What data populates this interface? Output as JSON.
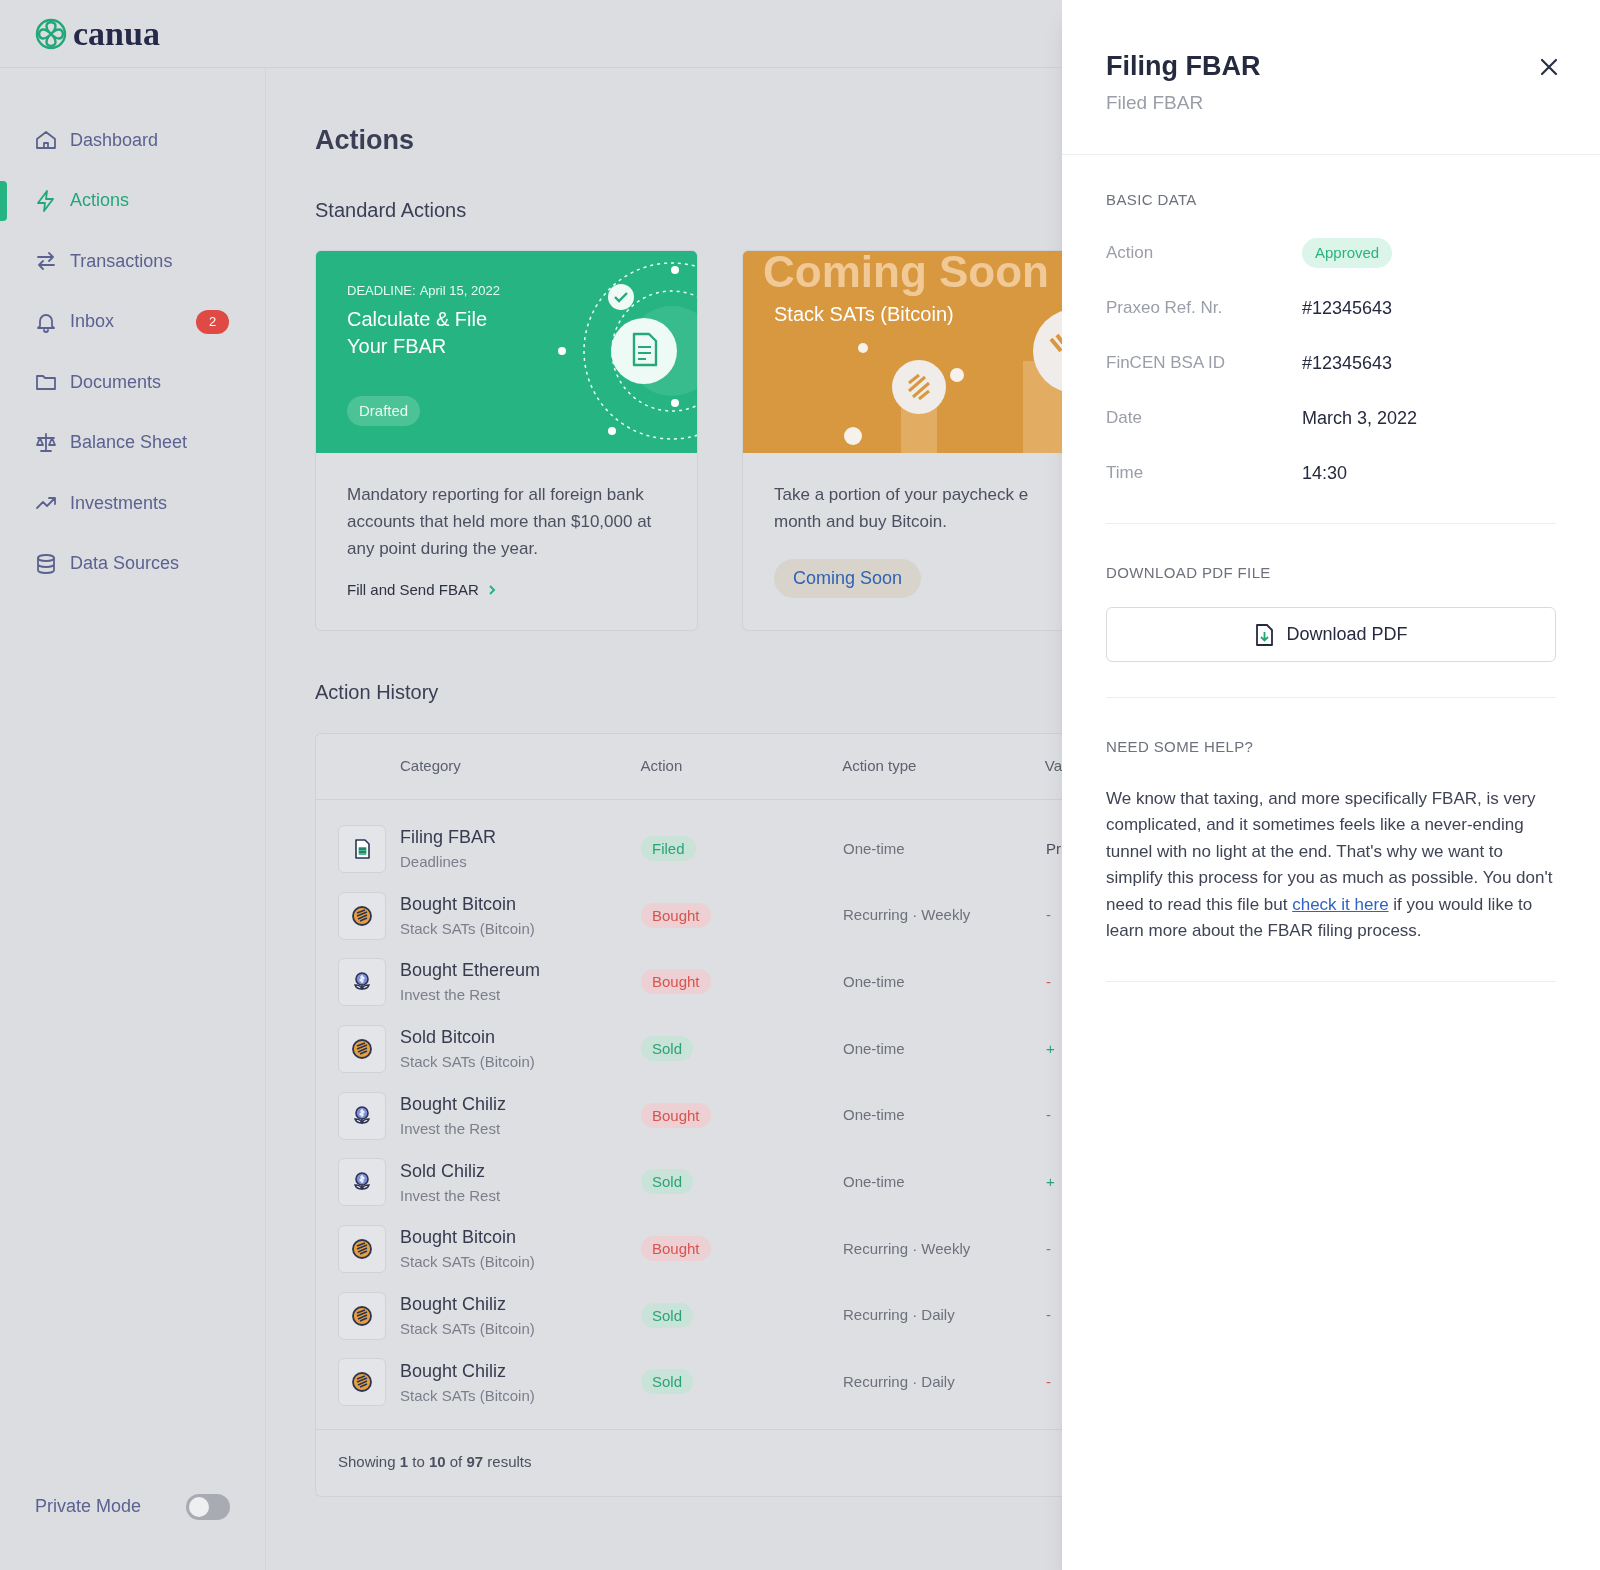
{
  "logo": {
    "text": "canua"
  },
  "sidebar": {
    "items": [
      {
        "label": "Dashboard",
        "selected": false
      },
      {
        "label": "Actions",
        "selected": true
      },
      {
        "label": "Transactions",
        "selected": false
      },
      {
        "label": "Inbox",
        "selected": false,
        "badge": "2"
      },
      {
        "label": "Documents",
        "selected": false
      },
      {
        "label": "Balance Sheet",
        "selected": false
      },
      {
        "label": "Investments",
        "selected": false
      },
      {
        "label": "Data Sources",
        "selected": false
      }
    ],
    "private_mode": {
      "label": "Private Mode",
      "on": false
    }
  },
  "page_title": "Actions",
  "standard_actions": {
    "heading": "Standard Actions",
    "cards": [
      {
        "kind": "green",
        "deadline_label": "DEADLINE:",
        "deadline": "April 15, 2022",
        "title": "Calculate & File Your FBAR",
        "status": "Drafted",
        "description": [
          "Mandatory reporting for all foreign bank accounts that held more than $10,000 at any point during the year."
        ],
        "link": "Fill and Send FBAR"
      },
      {
        "kind": "orange",
        "watermark": "Coming Soon",
        "title": "Stack SATs (Bitcoin)",
        "description": [
          "Take a portion of your paycheck e",
          "month and buy Bitcoin."
        ],
        "button": "Coming Soon"
      }
    ]
  },
  "action_history": {
    "heading": "Action History",
    "columns": [
      "Category",
      "Action",
      "Action type",
      "Va"
    ],
    "rows": [
      {
        "kind": "document",
        "title": "Filing FBAR",
        "subtitle": "Deadlines",
        "status": {
          "label": "Filed",
          "kind": "positive"
        },
        "type": "One-time",
        "value": {
          "text": "Pr",
          "kind": "neutral"
        }
      },
      {
        "kind": "coin",
        "title": "Bought Bitcoin",
        "subtitle": "Stack SATs (Bitcoin)",
        "status": {
          "label": "Bought",
          "kind": "negative"
        },
        "type": "Recurring · Weekly",
        "value": {
          "text": "-",
          "kind": "negative"
        }
      },
      {
        "kind": "plant",
        "title": "Bought Ethereum",
        "subtitle": "Invest the Rest",
        "status": {
          "label": "Bought",
          "kind": "negative"
        },
        "type": "One-time",
        "value": {
          "text": "-",
          "kind": "negative"
        }
      },
      {
        "kind": "coin",
        "title": "Sold Bitcoin",
        "subtitle": "Stack SATs (Bitcoin)",
        "status": {
          "label": "Sold",
          "kind": "positive"
        },
        "type": "One-time",
        "value": {
          "text": "+",
          "kind": "positive"
        }
      },
      {
        "kind": "plant",
        "title": "Bought Chiliz",
        "subtitle": "Invest the Rest",
        "status": {
          "label": "Bought",
          "kind": "negative"
        },
        "type": "One-time",
        "value": {
          "text": "-",
          "kind": "negative"
        }
      },
      {
        "kind": "plant",
        "title": "Sold Chiliz",
        "subtitle": "Invest the Rest",
        "status": {
          "label": "Sold",
          "kind": "positive"
        },
        "type": "One-time",
        "value": {
          "text": "+",
          "kind": "positive"
        }
      },
      {
        "kind": "coin",
        "title": "Bought Bitcoin",
        "subtitle": "Stack SATs (Bitcoin)",
        "status": {
          "label": "Bought",
          "kind": "negative"
        },
        "type": "Recurring · Weekly",
        "value": {
          "text": "-",
          "kind": "negative"
        }
      },
      {
        "kind": "coin",
        "title": "Bought Chiliz",
        "subtitle": "Stack SATs (Bitcoin)",
        "status": {
          "label": "Sold",
          "kind": "positive"
        },
        "type": "Recurring · Daily",
        "value": {
          "text": "-",
          "kind": "negative"
        }
      },
      {
        "kind": "coin",
        "title": "Bought Chiliz",
        "subtitle": "Stack SATs (Bitcoin)",
        "status": {
          "label": "Sold",
          "kind": "positive"
        },
        "type": "Recurring · Daily",
        "value": {
          "text": "-",
          "kind": "negative"
        }
      }
    ],
    "footer": "Showing **1** to **10** of **97** results"
  },
  "panel": {
    "title": "Filing FBAR",
    "subtitle": "Filed FBAR",
    "basic_data": {
      "heading": "BASIC DATA",
      "fields": [
        {
          "label": "Action",
          "value": "Approved",
          "kind": "badge"
        },
        {
          "label": "Praxeo Ref. Nr.",
          "value": "#12345643",
          "kind": "text"
        },
        {
          "label": "FinCEN BSA ID",
          "value": "#12345643",
          "kind": "text"
        },
        {
          "label": "Date",
          "value": "March 3, 2022",
          "kind": "text"
        },
        {
          "label": "Time",
          "value": "14:30",
          "kind": "text"
        }
      ]
    },
    "download": {
      "heading": "DOWNLOAD PDF FILE",
      "button": "Download PDF"
    },
    "help": {
      "heading": "NEED SOME HELP?",
      "text_before": "We know that taxing, and more specifically FBAR, is very complicated, and it sometimes feels like a never-ending tunnel with no light at the end. That's why we want to simplify this process for you as much as possible. You don't need to read this file but",
      "link": "check it here",
      "text_after": "if you would like to learn more about the FBAR filing process."
    }
  }
}
